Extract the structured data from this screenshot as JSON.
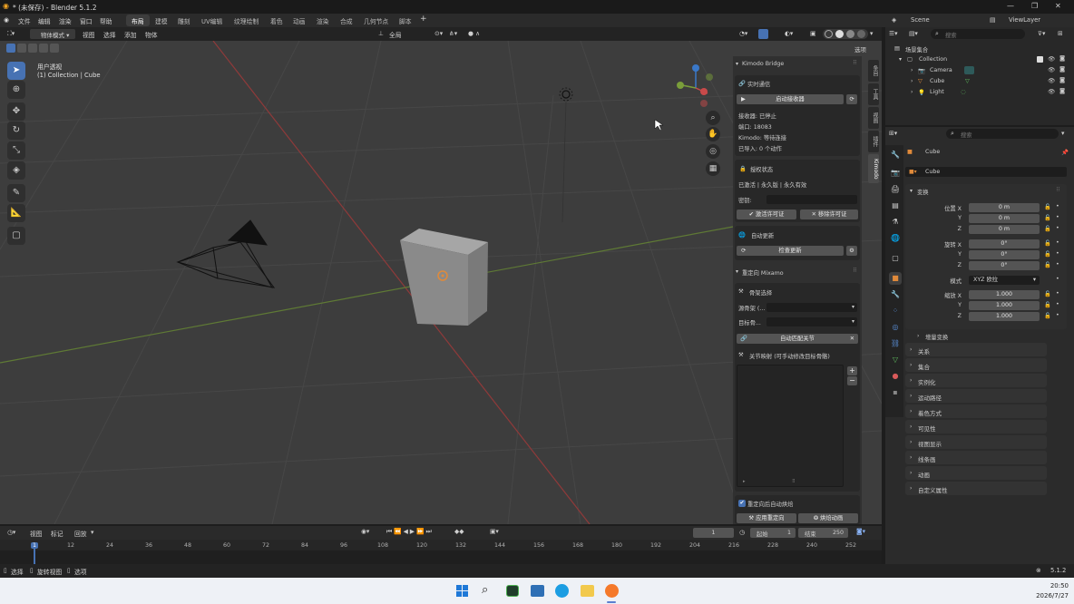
{
  "window": {
    "title": "* (未保存) - Blender 5.1.2"
  },
  "menu": [
    "文件",
    "编辑",
    "渲染",
    "窗口",
    "帮助"
  ],
  "workspaces": [
    "布局",
    "建模",
    "雕刻",
    "UV编辑",
    "纹理绘制",
    "着色",
    "动画",
    "渲染",
    "合成",
    "几何节点",
    "脚本"
  ],
  "topbar": {
    "scene": "Scene",
    "viewlayer": "ViewLayer"
  },
  "viewport_header": {
    "mode": "物体模式",
    "menus": [
      "视图",
      "选择",
      "添加",
      "物体"
    ],
    "orientation": "全局",
    "options": "选项"
  },
  "viewport": {
    "view_name": "用户透视",
    "collection_info": "(1) Collection | Cube"
  },
  "npanel": {
    "title": "Kimodo Bridge",
    "tabs": [
      "条目",
      "工具",
      "视图",
      "插件",
      "Kimodo"
    ],
    "realtime": {
      "header": "实时通信",
      "start_btn": "启动接收器",
      "receiver": "接收器: 已停止",
      "port": "端口: 18083",
      "kimodo": "Kimodo: 等待连接",
      "imported": "已导入: 0 个动作"
    },
    "license": {
      "header": "授权状态",
      "status": "已激活 | 永久版 | 永久有效",
      "key_label": "密钥:",
      "activate_btn": "激活许可证",
      "remove_btn": "移除许可证"
    },
    "update": {
      "header": "自动更新",
      "check_btn": "检查更新"
    },
    "retarget": {
      "header": "重定向 Mixamo",
      "skeleton": "骨架选择",
      "source": "源骨架 (...",
      "target": "目标骨...",
      "auto_btn": "自动匹配关节",
      "map_header": "关节映射 (可手动修改目标骨骼)",
      "auto_bake": "重定向后自动烘焙",
      "apply_btn": "应用重定向",
      "bake_btn": "烘焙动画"
    }
  },
  "outliner": {
    "search_placeholder": "搜索",
    "root": "场景集合",
    "items": [
      "Collection",
      "Camera",
      "Cube",
      "Light"
    ]
  },
  "properties": {
    "search_placeholder": "搜索",
    "object_name": "Cube",
    "data_name": "Cube",
    "transform_header": "变换",
    "location_label": "位置",
    "rotation_label": "旋转",
    "mode_label": "模式",
    "scale_label": "缩放",
    "axes": [
      "X",
      "Y",
      "Z"
    ],
    "location": [
      "0 m",
      "0 m",
      "0 m"
    ],
    "rotation": [
      "0°",
      "0°",
      "0°"
    ],
    "mode": "XYZ 欧拉",
    "scale": [
      "1.000",
      "1.000",
      "1.000"
    ],
    "delta": "增量变换",
    "sections": [
      "关系",
      "集合",
      "实例化",
      "运动路径",
      "着色方式",
      "可见性",
      "视图显示",
      "线条画",
      "动画",
      "自定义属性"
    ]
  },
  "timeline": {
    "menus": [
      "视图",
      "标记"
    ],
    "playback": "回放",
    "current_frame": "1",
    "start_label": "起始",
    "start": "1",
    "end_label": "结束",
    "end": "250",
    "ticks": [
      "1",
      "12",
      "24",
      "36",
      "48",
      "60",
      "72",
      "84",
      "96",
      "108",
      "120",
      "132",
      "144",
      "156",
      "168",
      "180",
      "192",
      "204",
      "216",
      "228",
      "240",
      "252"
    ]
  },
  "statusbar": {
    "items": [
      "选择",
      "旋转视图",
      "选项"
    ],
    "version": "5.1.2"
  },
  "taskbar": {
    "time": "20:50",
    "date": "2026/7/27"
  },
  "colors": {
    "accent": "#4772b3",
    "viewport_bg": "#3d3d3d",
    "x_axis": "#c84a4a",
    "y_axis": "#7a9e3a",
    "z_axis": "#3a78c8"
  }
}
